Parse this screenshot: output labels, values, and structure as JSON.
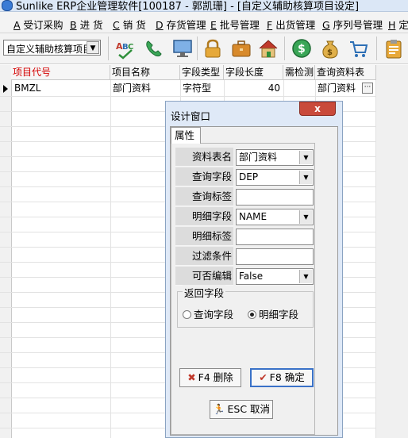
{
  "window": {
    "title": "Sunlike ERP企业管理软件[100187 - 郭凯珊] - [自定义辅助核算项目设定]"
  },
  "menu": [
    {
      "key": "A",
      "label": "受订采购"
    },
    {
      "key": "B",
      "label": "进 货"
    },
    {
      "key": "C",
      "label": "销 货"
    },
    {
      "key": "D",
      "label": "存货管理"
    },
    {
      "key": "E",
      "label": "批号管理"
    },
    {
      "key": "F",
      "label": "出货管理"
    },
    {
      "key": "G",
      "label": "序列号管理"
    },
    {
      "key": "H",
      "label": "定"
    }
  ],
  "toolbar": {
    "combo_value": "自定义辅助核算项目",
    "icons": [
      "abc-spell-icon",
      "phone-icon",
      "monitor-icon",
      "lock-icon",
      "briefcase-icon",
      "house-icon",
      "dollar-coin-icon",
      "money-bag-icon",
      "cart-icon",
      "clipboard-icon"
    ]
  },
  "grid": {
    "columns": [
      "项目代号",
      "项目名称",
      "字段类型",
      "字段长度",
      "需检测",
      "查询资料表"
    ],
    "rows": [
      {
        "code": "BMZL",
        "name": "部门资料",
        "type": "字符型",
        "length": "40",
        "check": "",
        "table": "部门资料"
      }
    ]
  },
  "dialog": {
    "title": "设计窗口",
    "close_label": "x",
    "tab": "属性",
    "props": [
      {
        "label": "资料表名",
        "value": "部门资料",
        "dropdown": true
      },
      {
        "label": "查询字段",
        "value": "DEP",
        "dropdown": true
      },
      {
        "label": "查询标签",
        "value": "",
        "dropdown": false
      },
      {
        "label": "明细字段",
        "value": "NAME",
        "dropdown": true
      },
      {
        "label": "明细标签",
        "value": "",
        "dropdown": false
      },
      {
        "label": "过滤条件",
        "value": "",
        "dropdown": false
      },
      {
        "label": "可否编辑",
        "value": "False",
        "dropdown": true
      }
    ],
    "group_title": "返回字段",
    "radio_query": "查询字段",
    "radio_detail": "明细字段",
    "radio_selected": "明细字段",
    "delete_label": "F4 删除",
    "confirm_label": "F8 确定",
    "cancel_label": "ESC 取消"
  }
}
